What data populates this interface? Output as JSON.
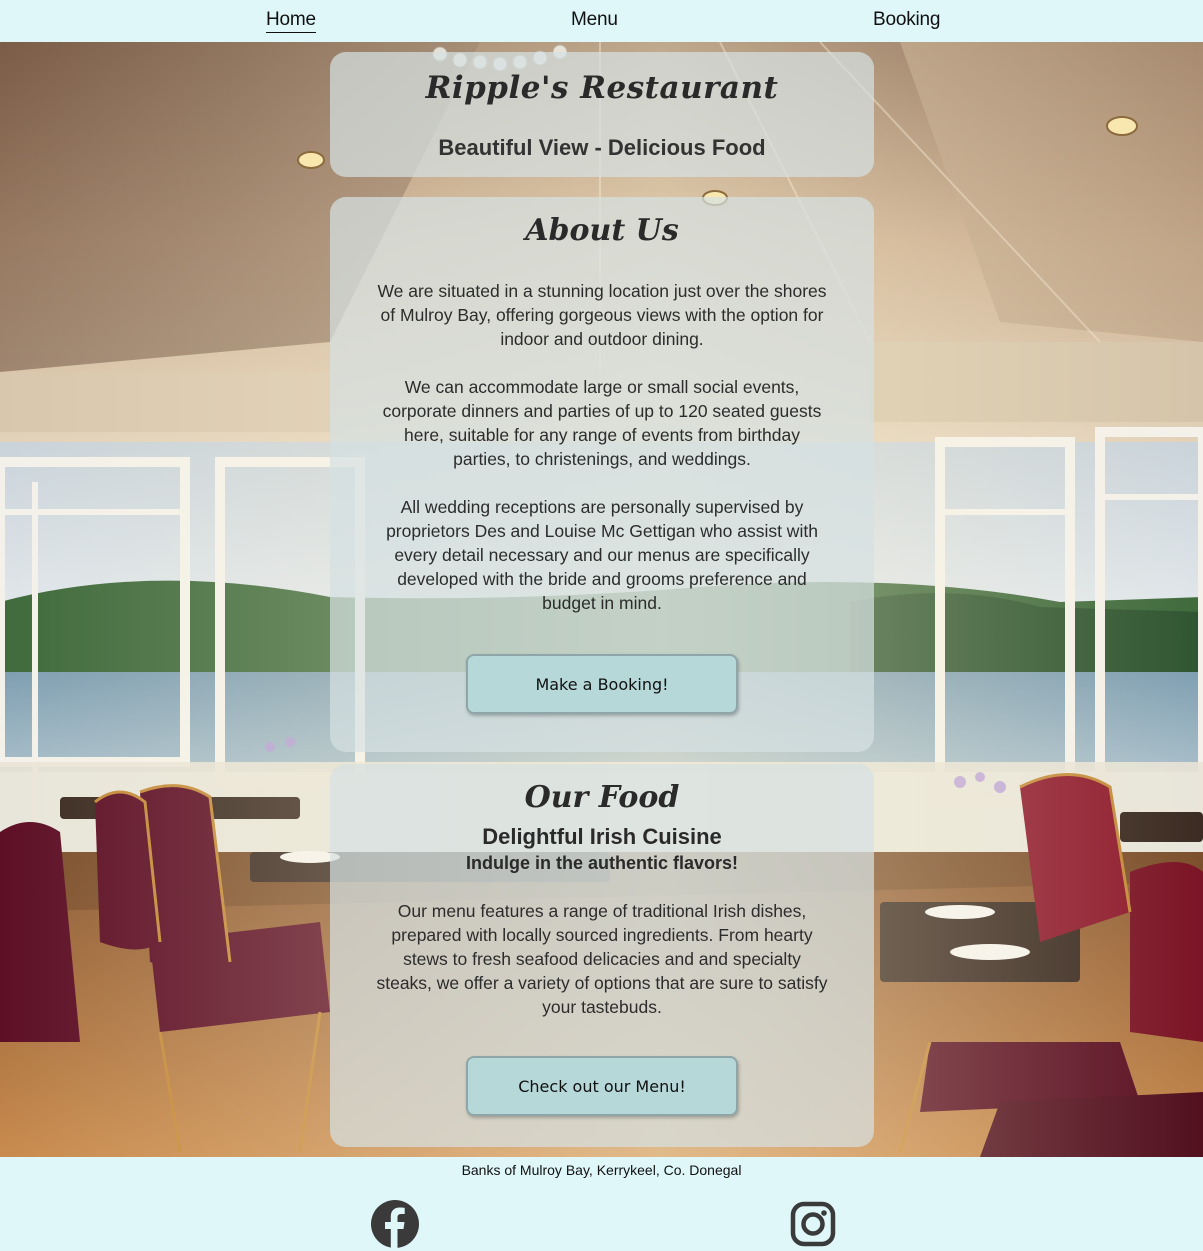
{
  "nav": {
    "items": [
      {
        "label": "Home",
        "active": true
      },
      {
        "label": "Menu",
        "active": false
      },
      {
        "label": "Booking",
        "active": false
      }
    ]
  },
  "hero": {
    "title": "Ripple's Restaurant",
    "tagline": "Beautiful View - Delicious Food"
  },
  "about": {
    "heading": "About Us",
    "paragraphs": [
      "We are situated in a stunning location just over the shores of Mulroy Bay, offering gorgeous views with the option for indoor and outdoor dining.",
      "We can accommodate large or small social events, corporate dinners and parties of up to 120 seated guests here, suitable for any range of events from birthday parties, to christenings, and weddings.",
      "All wedding receptions are personally supervised by proprietors Des and Louise Mc Gettigan who assist with every detail necessary and our menus are specifically developed with the bride and grooms preference and budget in mind."
    ],
    "button_label": "Make a Booking!"
  },
  "food": {
    "heading": "Our Food",
    "subheading": "Delightful Irish Cuisine",
    "tagline": "Indulge in the authentic flavors!",
    "paragraph": "Our menu features a range of traditional Irish dishes, prepared with locally sourced ingredients. From hearty stews to fresh seafood delicacies and and specialty steaks, we offer a variety of options that are sure to satisfy your tastebuds.",
    "button_label": "Check out our Menu!"
  },
  "footer": {
    "address": "Banks of Mulroy Bay, Kerrykeel, Co. Donegal",
    "social_icons": [
      "facebook-icon",
      "instagram-icon"
    ]
  },
  "colors": {
    "nav_bg": "#dff7f9",
    "card_bg": "#d6e0e2",
    "button_bg": "#b6d8d9"
  }
}
